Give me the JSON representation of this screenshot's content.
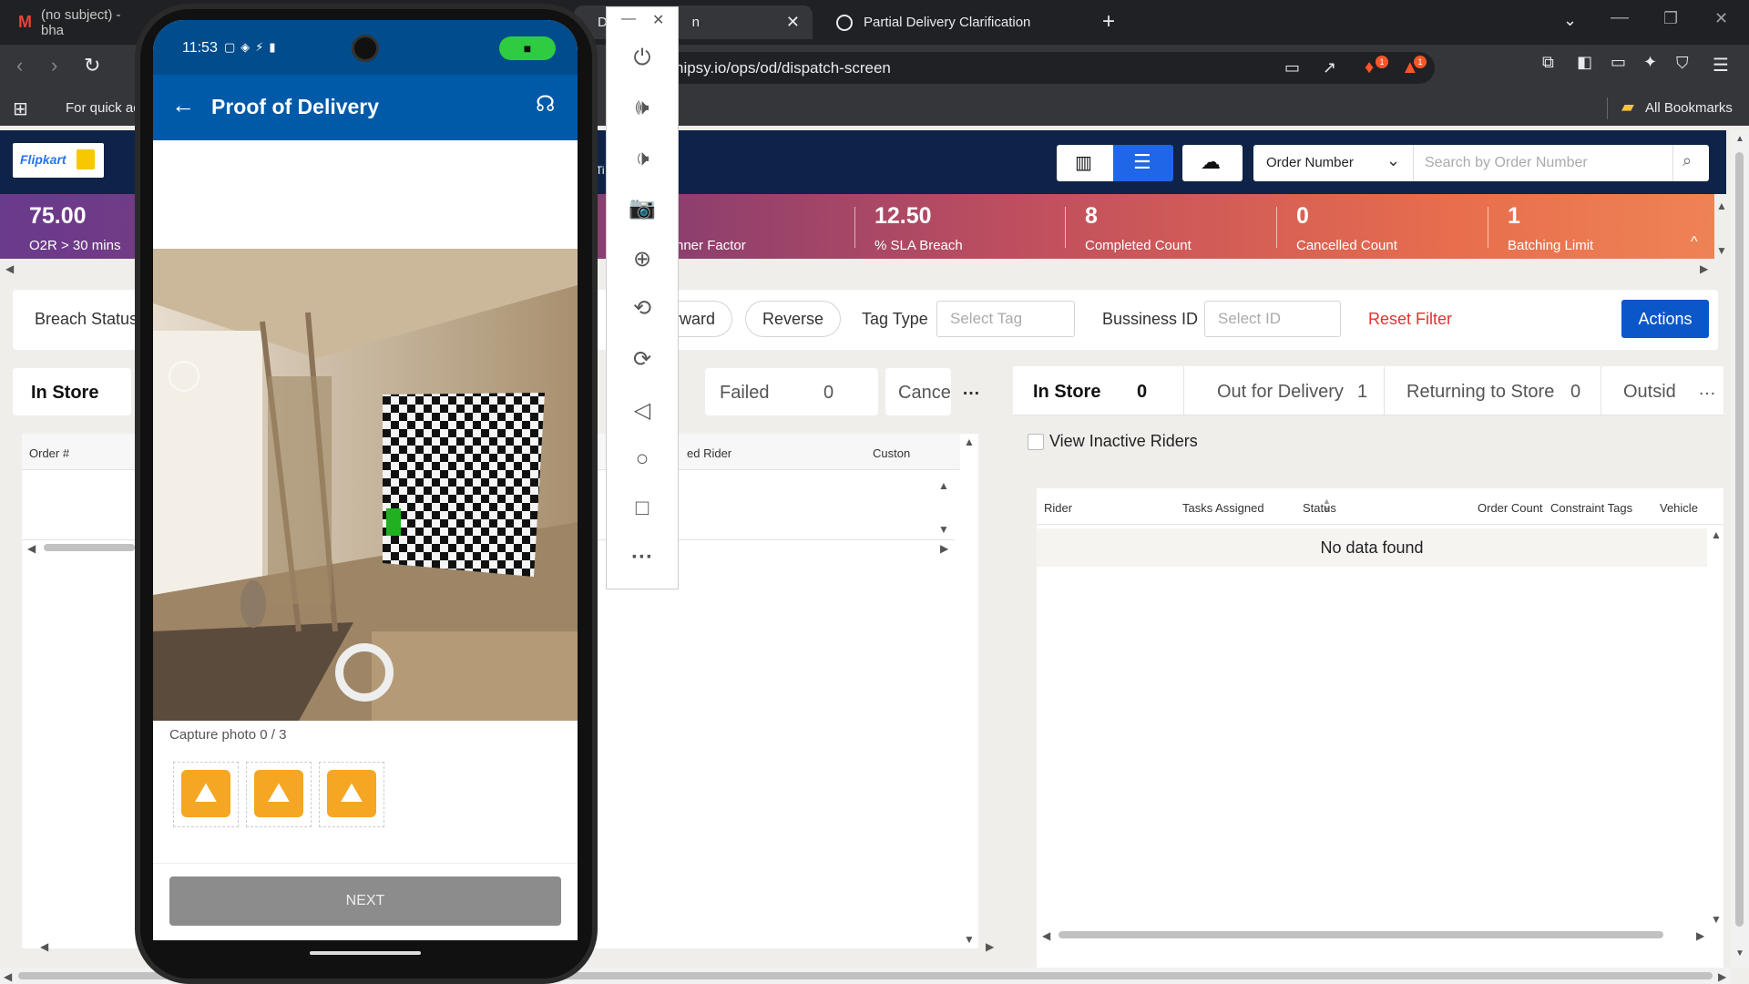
{
  "browser": {
    "tabs": [
      {
        "label": "(no subject) - bha",
        "active": false
      },
      {
        "label": "Dis",
        "active": true
      },
      {
        "label": "n",
        "active": true
      },
      {
        "label": "Partial Delivery Clarification",
        "active": false
      }
    ],
    "url": "hipsy.io/ops/od/dispatch-screen",
    "url_prefix": "s",
    "bookmarks_hint": "For quick ac",
    "all_bookmarks": "All Bookmarks",
    "badge_brave": "1",
    "badge_alert": "1"
  },
  "app": {
    "logo": "Flipkart",
    "search_select": "Order Number",
    "search_placeholder": "Search by Order Number",
    "stats": [
      {
        "value": "75.00",
        "label": "O2R > 30 mins"
      },
      {
        "value": "",
        "label": "nner Factor"
      },
      {
        "value": "12.50",
        "label": "% SLA Breach"
      },
      {
        "value": "8",
        "label": "Completed Count"
      },
      {
        "value": "0",
        "label": "Cancelled Count"
      },
      {
        "value": "1",
        "label": "Batching Limit"
      }
    ],
    "filters": {
      "breach_status": "Breach Status",
      "forward": "rward",
      "reverse": "Reverse",
      "tag_type": "Tag Type",
      "tag_placeholder": "Select Tag",
      "business_id": "Bussiness ID",
      "id_placeholder": "Select ID",
      "reset": "Reset Filter",
      "actions": "Actions"
    },
    "orders_panel": {
      "tab_in_store": "In Store",
      "tab_failed": "Failed",
      "tab_failed_count": "0",
      "tab_cancelled": "Cance",
      "more": "…",
      "col_order": "Order #",
      "col_rider": "ed Rider",
      "col_customer": "Custon",
      "tiny_label": "Ti"
    },
    "riders_panel": {
      "tabs": [
        {
          "label": "In Store",
          "count": "0"
        },
        {
          "label": "Out for Delivery",
          "count": "1"
        },
        {
          "label": "Returning to Store",
          "count": "0"
        },
        {
          "label": "Outsid",
          "count": ""
        }
      ],
      "more": "…",
      "view_inactive": "View Inactive Riders",
      "columns": [
        "Rider",
        "Tasks Assigned",
        "Status",
        "Order Count",
        "Constraint Tags",
        "Vehicle"
      ],
      "empty": "No data found"
    }
  },
  "phone": {
    "time": "11:53",
    "title": "Proof of Delivery",
    "capture_text": "Capture photo 0 / 3",
    "next": "NEXT"
  },
  "colors": {
    "brand_blue": "#005aa8",
    "actions_blue": "#0b57c9",
    "reset_red": "#e0342c",
    "thumb_orange": "#f5a623"
  }
}
